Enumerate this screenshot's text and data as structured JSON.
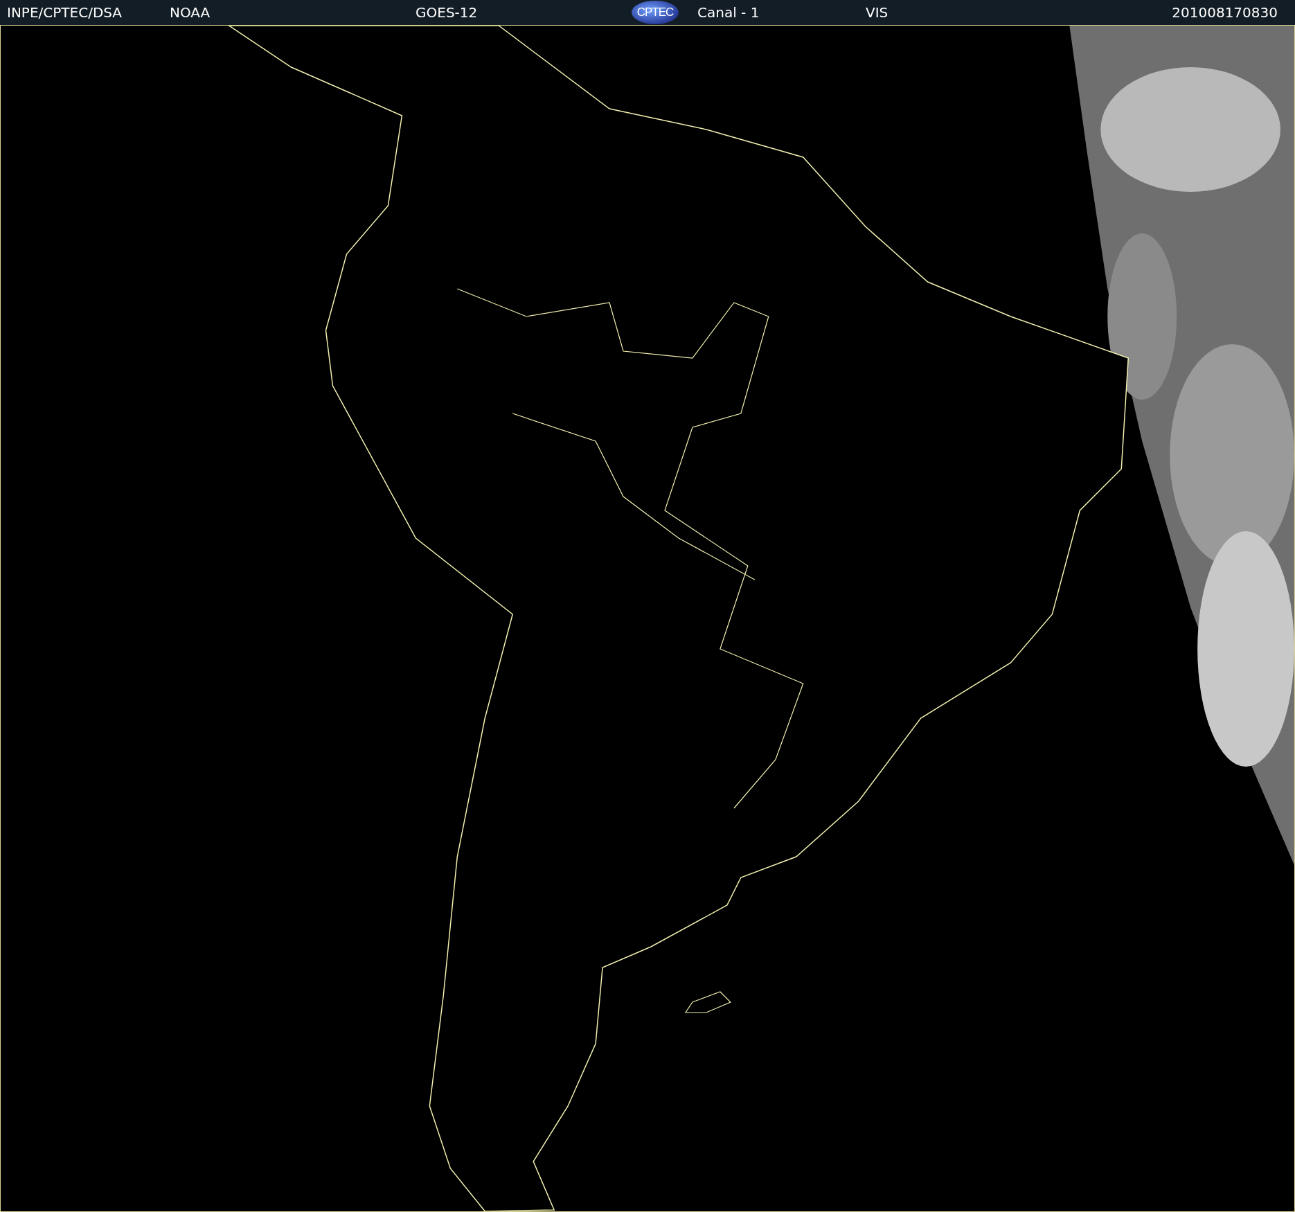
{
  "header": {
    "items": [
      {
        "kind": "text",
        "text": "INPE/CPTEC/DSA"
      },
      {
        "kind": "text",
        "text": "NOAA"
      },
      {
        "kind": "text",
        "text": "GOES-12"
      },
      {
        "kind": "logo",
        "text": "CPTEC"
      },
      {
        "kind": "text",
        "text": "Canal - 1"
      },
      {
        "kind": "text",
        "text": "VIS"
      },
      {
        "kind": "text",
        "text": "201008170830"
      }
    ]
  }
}
